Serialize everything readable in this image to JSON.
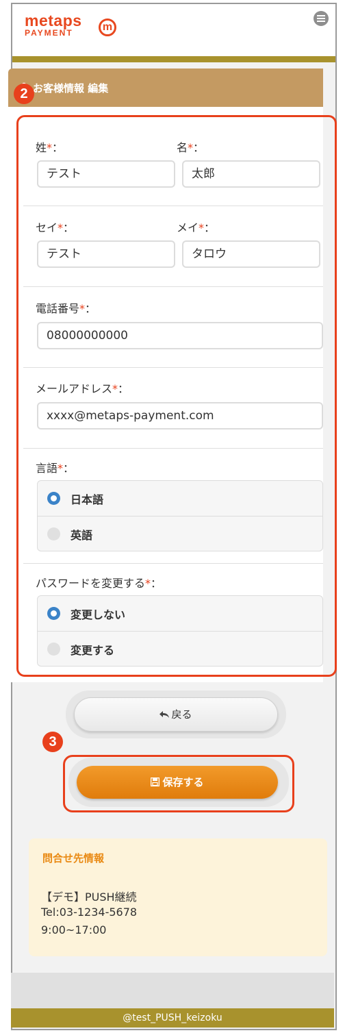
{
  "header": {
    "logo_top": "metaps",
    "logo_bottom": "PAYMENT",
    "logo_mark": "m",
    "menu_icon": "hamburger-menu-icon"
  },
  "panel": {
    "title": "お客様情報 編集",
    "icon": "person-icon"
  },
  "badges": {
    "form": "2",
    "save": "3"
  },
  "form": {
    "last_name": {
      "label": "姓",
      "value": "テスト"
    },
    "first_name": {
      "label": "名",
      "value": "太郎"
    },
    "last_name_kana": {
      "label": "セイ",
      "value": "テスト"
    },
    "first_name_kana": {
      "label": "メイ",
      "value": "タロウ"
    },
    "phone": {
      "label": "電話番号",
      "value": "08000000000"
    },
    "email": {
      "label": "メールアドレス",
      "value": "xxxx@metaps-payment.com"
    },
    "language": {
      "label": "言語",
      "options": [
        "日本語",
        "英語"
      ],
      "selected": "日本語"
    },
    "password_change": {
      "label": "パスワードを変更する",
      "options": [
        "変更しない",
        "変更する"
      ],
      "selected": "変更しない"
    },
    "required_mark": "*",
    "colon": "："
  },
  "buttons": {
    "back": "戻る",
    "save": "保存する"
  },
  "contact": {
    "title": "問合せ先情報",
    "name": "【デモ】PUSH継続",
    "tel": "Tel:03-1234-5678",
    "hours": "9:00~17:00"
  },
  "footer": {
    "text": "@test_PUSH_keizoku"
  },
  "colors": {
    "accent": "#e8481f",
    "gold": "#a8922d",
    "panel_header": "#c49a62",
    "save_button": "#ed8d1c",
    "radio_selected": "#3b83c8",
    "contact_bg": "#fdf3da"
  }
}
